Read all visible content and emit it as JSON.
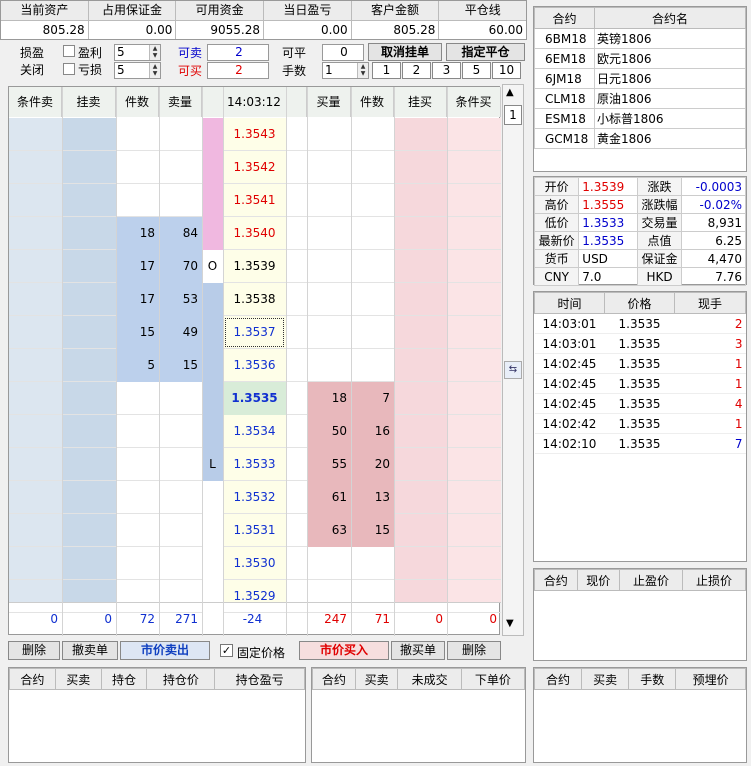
{
  "account": {
    "headers": [
      "当前资产",
      "占用保证金",
      "可用资金",
      "当日盈亏",
      "客户金额",
      "平仓线"
    ],
    "values": [
      "805.28",
      "0.00",
      "9055.28",
      "0.00",
      "805.28",
      "60.00"
    ]
  },
  "controls": {
    "sunying": "损盈",
    "guanbi": "关闭",
    "yingli": "盈利",
    "kuisun": "亏损",
    "yingli_val": "5",
    "kuisun_val": "5",
    "kemai_label": "可卖",
    "kemai_val": "2",
    "kemai2_label": "可买",
    "kemai2_val": "2",
    "keping_label": "可平",
    "keping_val": "0",
    "shoushu_label": "手数",
    "shoushu_val": "1",
    "cancel_btn": "取消挂单",
    "close_btn": "指定平仓",
    "qty_buttons": [
      "1",
      "2",
      "3",
      "5",
      "10"
    ]
  },
  "ladder": {
    "headers": [
      "条件卖",
      "挂卖",
      "件数",
      "卖量",
      "14:03:12",
      "买量",
      "件数",
      "挂买",
      "条件买"
    ],
    "rows": [
      {
        "price": "1.3543",
        "sell_cnt": "",
        "sell_vol": "",
        "buy_vol": "",
        "buy_cnt": "",
        "mark": ""
      },
      {
        "price": "1.3542",
        "sell_cnt": "",
        "sell_vol": "",
        "buy_vol": "",
        "buy_cnt": "",
        "mark": ""
      },
      {
        "price": "1.3541",
        "sell_cnt": "",
        "sell_vol": "",
        "buy_vol": "",
        "buy_cnt": "",
        "mark": ""
      },
      {
        "price": "1.3540",
        "sell_cnt": "18",
        "sell_vol": "84",
        "buy_vol": "",
        "buy_cnt": "",
        "mark": ""
      },
      {
        "price": "1.3539",
        "sell_cnt": "17",
        "sell_vol": "70",
        "buy_vol": "",
        "buy_cnt": "",
        "mark": "O"
      },
      {
        "price": "1.3538",
        "sell_cnt": "17",
        "sell_vol": "53",
        "buy_vol": "",
        "buy_cnt": "",
        "mark": ""
      },
      {
        "price": "1.3537",
        "sell_cnt": "15",
        "sell_vol": "49",
        "buy_vol": "",
        "buy_cnt": "",
        "mark": ""
      },
      {
        "price": "1.3536",
        "sell_cnt": "5",
        "sell_vol": "15",
        "buy_vol": "",
        "buy_cnt": "",
        "mark": ""
      },
      {
        "price": "1.3535",
        "sell_cnt": "",
        "sell_vol": "",
        "buy_vol": "18",
        "buy_cnt": "7",
        "mark": ""
      },
      {
        "price": "1.3534",
        "sell_cnt": "",
        "sell_vol": "",
        "buy_vol": "50",
        "buy_cnt": "16",
        "mark": ""
      },
      {
        "price": "1.3533",
        "sell_cnt": "",
        "sell_vol": "",
        "buy_vol": "55",
        "buy_cnt": "20",
        "mark": "L"
      },
      {
        "price": "1.3532",
        "sell_cnt": "",
        "sell_vol": "",
        "buy_vol": "61",
        "buy_cnt": "13",
        "mark": ""
      },
      {
        "price": "1.3531",
        "sell_cnt": "",
        "sell_vol": "",
        "buy_vol": "63",
        "buy_cnt": "15",
        "mark": ""
      },
      {
        "price": "1.3530",
        "sell_cnt": "",
        "sell_vol": "",
        "buy_vol": "",
        "buy_cnt": "",
        "mark": ""
      },
      {
        "price": "1.3529",
        "sell_cnt": "",
        "sell_vol": "",
        "buy_vol": "",
        "buy_cnt": "",
        "mark": ""
      }
    ],
    "totals": [
      "0",
      "0",
      "72",
      "271",
      "-24",
      "247",
      "71",
      "0",
      "0"
    ],
    "scroll_val": "1"
  },
  "actions": {
    "del1": "删除",
    "cancel_sell": "撤卖单",
    "market_sell": "市价卖出",
    "fixed_price": "固定价格",
    "market_buy": "市价买入",
    "cancel_buy": "撤买单",
    "del2": "删除"
  },
  "contracts": {
    "headers": [
      "合约",
      "合约名"
    ],
    "rows": [
      [
        "6BM18",
        "英镑1806"
      ],
      [
        "6EM18",
        "欧元1806"
      ],
      [
        "6JM18",
        "日元1806"
      ],
      [
        "CLM18",
        "原油1806"
      ],
      [
        "ESM18",
        "小标普1806"
      ],
      [
        "GCM18",
        "黄金1806"
      ]
    ]
  },
  "quote": {
    "rows": [
      [
        "开价",
        "1.3539",
        "涨跌",
        "-0.0003"
      ],
      [
        "高价",
        "1.3555",
        "涨跌幅",
        "-0.02%"
      ],
      [
        "低价",
        "1.3533",
        "交易量",
        "8,931"
      ],
      [
        "最新价",
        "1.3535",
        "点值",
        "6.25"
      ],
      [
        "货币",
        "USD",
        "保证金",
        "4,470"
      ],
      [
        "CNY",
        "7.0",
        "HKD",
        "7.76"
      ]
    ]
  },
  "ticks": {
    "headers": [
      "时间",
      "价格",
      "现手"
    ],
    "rows": [
      [
        "14:03:01",
        "1.3535",
        "2"
      ],
      [
        "14:03:01",
        "1.3535",
        "3"
      ],
      [
        "14:02:45",
        "1.3535",
        "1"
      ],
      [
        "14:02:45",
        "1.3535",
        "1"
      ],
      [
        "14:02:45",
        "1.3535",
        "4"
      ],
      [
        "14:02:42",
        "1.3535",
        "1"
      ],
      [
        "14:02:10",
        "1.3535",
        "7"
      ]
    ]
  },
  "stop_table": {
    "headers": [
      "合约",
      "现价",
      "止盈价",
      "止损价"
    ]
  },
  "pos_table": {
    "headers": [
      "合约",
      "买卖",
      "持仓",
      "持仓价",
      "持仓盈亏"
    ]
  },
  "order_table": {
    "headers": [
      "合约",
      "买卖",
      "未成交",
      "下单价"
    ]
  },
  "cond_table": {
    "headers": [
      "合约",
      "买卖",
      "手数",
      "预埋价"
    ]
  }
}
